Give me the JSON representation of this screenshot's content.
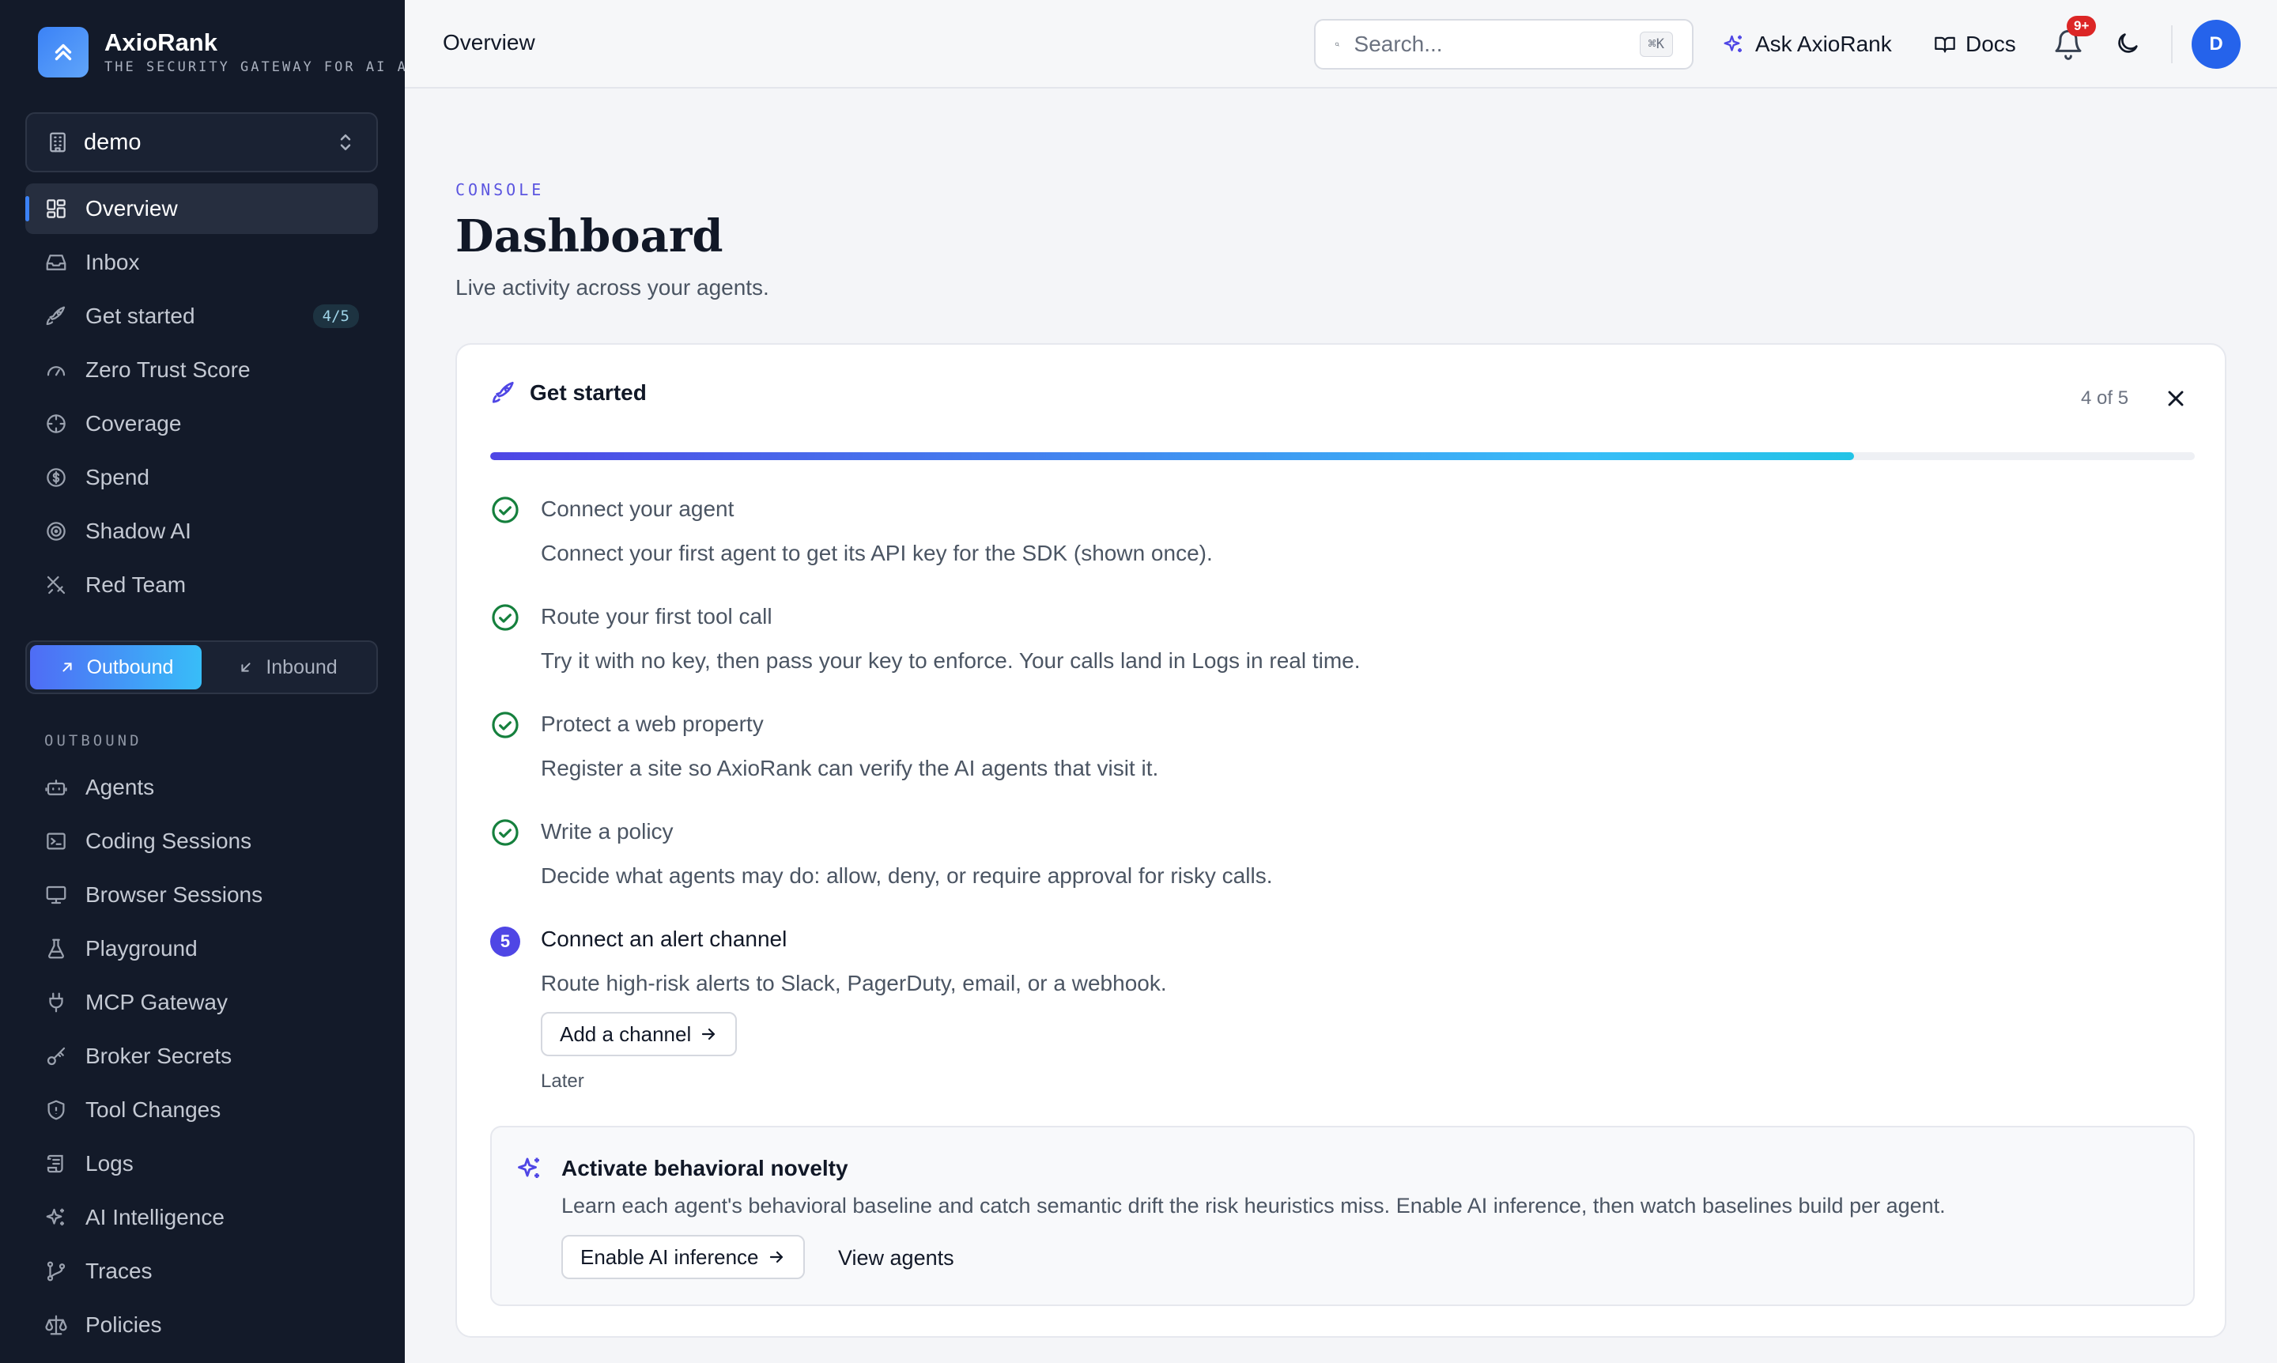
{
  "brand": {
    "name": "AxioRank",
    "tagline": "THE SECURITY GATEWAY FOR AI AGENTS"
  },
  "org": {
    "name": "demo"
  },
  "nav_primary": [
    {
      "label": "Overview",
      "icon": "grid-icon",
      "active": true
    },
    {
      "label": "Inbox",
      "icon": "inbox-icon"
    },
    {
      "label": "Get started",
      "icon": "rocket-icon",
      "badge": "4/5"
    },
    {
      "label": "Zero Trust Score",
      "icon": "gauge-icon"
    },
    {
      "label": "Coverage",
      "icon": "crosshair-icon"
    },
    {
      "label": "Spend",
      "icon": "dollar-icon"
    },
    {
      "label": "Shadow AI",
      "icon": "radar-icon"
    },
    {
      "label": "Red Team",
      "icon": "swords-icon"
    }
  ],
  "direction_toggle": {
    "outbound": "Outbound",
    "inbound": "Inbound",
    "selected": "outbound"
  },
  "outbound_section": {
    "label": "OUTBOUND",
    "items": [
      {
        "label": "Agents",
        "icon": "bot-icon"
      },
      {
        "label": "Coding Sessions",
        "icon": "terminal-icon"
      },
      {
        "label": "Browser Sessions",
        "icon": "monitor-icon"
      },
      {
        "label": "Playground",
        "icon": "flask-icon"
      },
      {
        "label": "MCP Gateway",
        "icon": "plug-icon"
      },
      {
        "label": "Broker Secrets",
        "icon": "key-icon"
      },
      {
        "label": "Tool Changes",
        "icon": "shield-icon"
      },
      {
        "label": "Logs",
        "icon": "scroll-icon"
      },
      {
        "label": "AI Intelligence",
        "icon": "sparkles-icon"
      },
      {
        "label": "Traces",
        "icon": "git-branch-icon"
      },
      {
        "label": "Policies",
        "icon": "scale-icon"
      }
    ]
  },
  "topbar": {
    "breadcrumb": "Overview",
    "search_placeholder": "Search...",
    "search_shortcut": "⌘K",
    "ask_label": "Ask AxioRank",
    "docs_label": "Docs",
    "notifications_badge": "9+",
    "avatar_initial": "D"
  },
  "page": {
    "eyebrow": "CONSOLE",
    "title": "Dashboard",
    "subtitle": "Live activity across your agents."
  },
  "get_started": {
    "title": "Get started",
    "count_label": "4 of 5",
    "progress_fraction": 0.8,
    "steps": [
      {
        "title": "Connect your agent",
        "desc": "Connect your first agent to get its API key for the SDK (shown once).",
        "done": true
      },
      {
        "title": "Route your first tool call",
        "desc": "Try it with no key, then pass your key to enforce. Your calls land in Logs in real time.",
        "done": true
      },
      {
        "title": "Protect a web property",
        "desc": "Register a site so AxioRank can verify the AI agents that visit it.",
        "done": true
      },
      {
        "title": "Write a policy",
        "desc": "Decide what agents may do: allow, deny, or require approval for risky calls.",
        "done": true
      },
      {
        "title": "Connect an alert channel",
        "desc": "Route high-risk alerts to Slack, PagerDuty, email, or a webhook.",
        "done": false,
        "number": "5"
      }
    ],
    "cta_label": "Add a channel",
    "later_label": "Later"
  },
  "novelty": {
    "title": "Activate behavioral novelty",
    "desc": "Learn each agent's behavioral baseline and catch semantic drift the risk heuristics miss. Enable AI inference, then watch baselines build per agent.",
    "primary_label": "Enable AI inference",
    "secondary_label": "View agents"
  },
  "colors": {
    "accent": "#4f46e5",
    "brand_blue": "#3b82f6",
    "success": "#15803d",
    "sidebar_bg": "#131a29",
    "alert": "#dc2626"
  }
}
